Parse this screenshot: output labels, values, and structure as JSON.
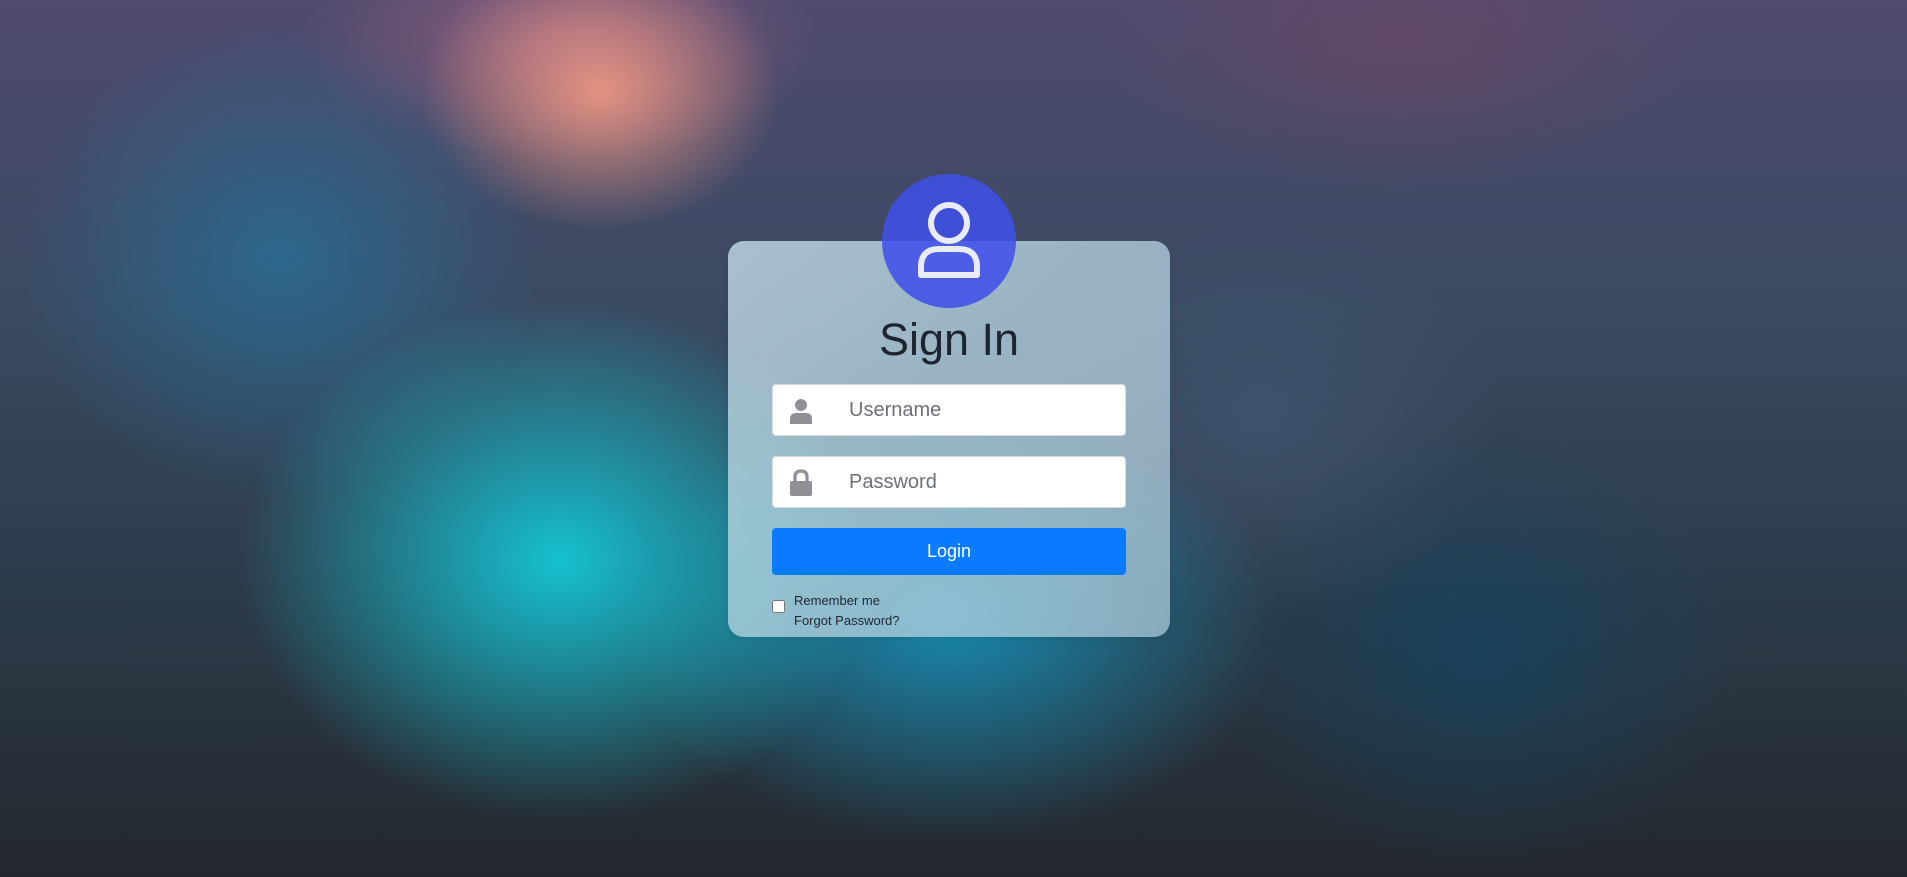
{
  "page": {
    "title": "Sign In"
  },
  "avatar": {
    "icon": "user-icon"
  },
  "form": {
    "username": {
      "icon": "user-icon",
      "placeholder": "Username",
      "value": ""
    },
    "password": {
      "icon": "lock-icon",
      "placeholder": "Password",
      "value": ""
    },
    "login_label": "Login",
    "remember_label": "Remember me",
    "remember_checked": false,
    "forgot_label": "Forgot Password?"
  },
  "colors": {
    "accent": "#0a7bff",
    "avatar": "#4555de",
    "title_text": "#1f2530"
  }
}
